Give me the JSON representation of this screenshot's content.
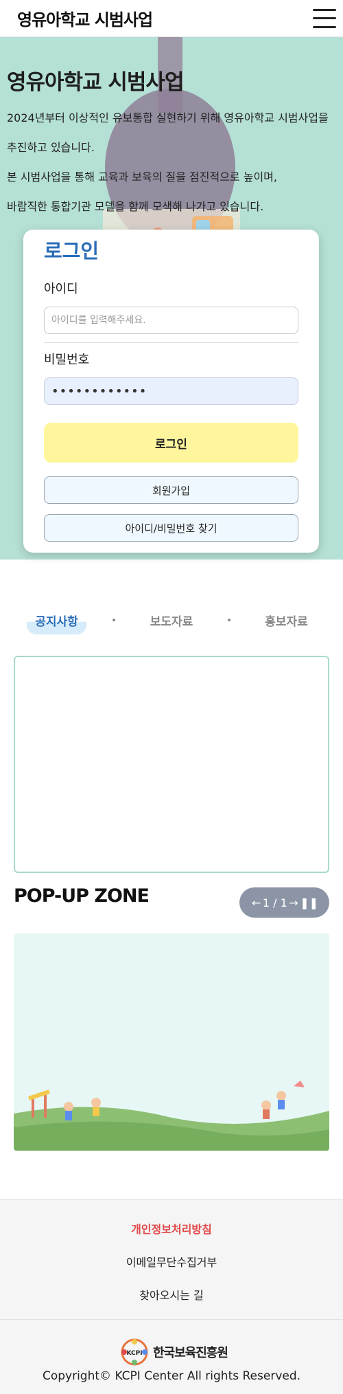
{
  "header": {
    "title": "영유아학교 시범사업"
  },
  "hero": {
    "title": "영유아학교 시범사업",
    "desc": [
      "2024년부터 이상적인 유보통합 실현하기 위해 영유아학교 시범사업을",
      "추진하고 있습니다.",
      "본 시범사업을 통해 교육과 보육의 질을 점진적으로 높이며,",
      "바람직한 통합기관 모델을 함께 모색해 나가고 있습니다."
    ]
  },
  "login": {
    "title": "로그인",
    "id_label": "아이디",
    "id_placeholder": "아이디를 입력해주세요.",
    "pw_label": "비밀번호",
    "pw_value": "••••••••••••",
    "login_button": "로그인",
    "signup_button": "회원가입",
    "find_button": "아이디/비밀번호 찾기"
  },
  "tabs": [
    {
      "label": "공지사항",
      "active": true
    },
    {
      "label": "보도자료",
      "active": false
    },
    {
      "label": "홍보자료",
      "active": false
    }
  ],
  "popup": {
    "title": "POP-UP ZONE",
    "prev": "←",
    "counter": "1 / 1",
    "next": "→",
    "pause": "❚❚"
  },
  "footer": {
    "links": [
      "개인정보처리방침",
      "이메일무단수집거부",
      "찾아오시는 길"
    ],
    "org_logo_text": "KCPI",
    "org_name": "한국보육진흥원",
    "copyright": "Copyright© KCPI Center All rights Reserved."
  },
  "colors": {
    "hero_bg": "#b5e0d5",
    "accent_blue": "#2a6db8",
    "login_button": "#fff59d",
    "privacy_link": "#e04a4a",
    "popup_ctrl": "#8b95a6"
  }
}
